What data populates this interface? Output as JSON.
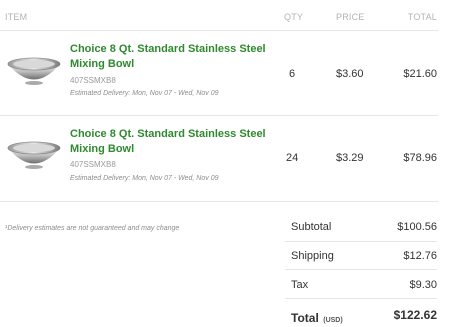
{
  "header": {
    "item": "ITEM",
    "qty": "QTY",
    "price": "PRICE",
    "total": "TOTAL"
  },
  "items": [
    {
      "title_line1": "Choice 8 Qt. Standard Stainless Steel",
      "title_line2": "Mixing Bowl",
      "sku": "407SSMXB8",
      "delivery": "Estimated Delivery: Mon, Nov 07 - Wed, Nov 09",
      "qty": "6",
      "price": "$3.60",
      "total": "$21.60",
      "image_icon": "mixing-bowl-icon"
    },
    {
      "title_line1": "Choice 8 Qt. Standard Stainless Steel",
      "title_line2": "Mixing Bowl",
      "sku": "407SSMXB8",
      "delivery": "Estimated Delivery: Mon, Nov 07 - Wed, Nov 09",
      "qty": "24",
      "price": "$3.29",
      "total": "$78.96",
      "image_icon": "mixing-bowl-icon"
    }
  ],
  "delivery_note": "¹Delivery estimates are not guaranteed and may change",
  "summary": {
    "subtotal_label": "Subtotal",
    "subtotal_value": "$100.56",
    "shipping_label": "Shipping",
    "shipping_value": "$12.76",
    "tax_label": "Tax",
    "tax_value": "$9.30",
    "total_label": "Total",
    "total_currency": "(USD)",
    "total_value": "$122.62"
  },
  "colors": {
    "title_green": "#2f8a2f",
    "divider": "#e6e6e6"
  }
}
